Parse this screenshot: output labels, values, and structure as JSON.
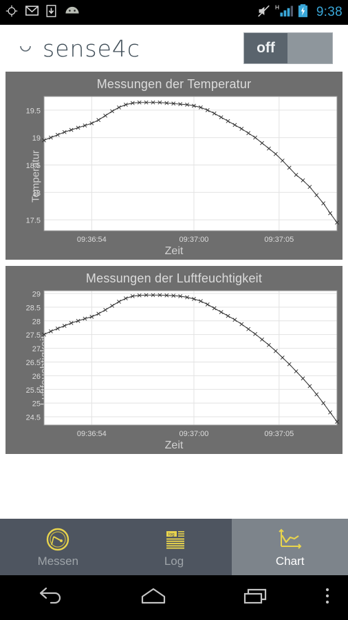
{
  "statusbar": {
    "icons_left": [
      "gps-icon",
      "gmail-icon",
      "download-icon",
      "android-icon"
    ],
    "icons_right": [
      "mute-icon",
      "signal-h-icon",
      "battery-charging-icon"
    ],
    "signal_label": "H",
    "clock": "9:38"
  },
  "header": {
    "logo_text": "sense4c",
    "toggle": {
      "label": "off",
      "state": "off"
    }
  },
  "charts": [
    {
      "title": "Messungen der Temperatur",
      "ylabel": "Temperatur",
      "xlabel": "Zeit"
    },
    {
      "title": "Messungen der Luftfeuchtigkeit",
      "ylabel": "Luftfeuchtigkeit",
      "xlabel": "Zeit"
    }
  ],
  "tabs": [
    {
      "label": "Messen",
      "icon": "gauge-icon",
      "active": false
    },
    {
      "label": "Log",
      "icon": "log-list-icon",
      "active": false
    },
    {
      "label": "Chart",
      "icon": "line-chart-icon",
      "active": true
    }
  ],
  "navbar": {
    "back": "back-icon",
    "home": "home-icon",
    "recents": "recents-icon",
    "overflow": "overflow-menu-icon"
  },
  "colors": {
    "accent_gold": "#e8d44d",
    "panel_bg": "#6e6e6e",
    "tabbar_bg": "#4e5560",
    "tab_active_bg": "#7d848b",
    "status_clock": "#3aa7d8",
    "logo": "#3f4d57"
  },
  "chart_data": [
    {
      "type": "line",
      "title": "Messungen der Temperatur",
      "xlabel": "Zeit",
      "ylabel": "Temperatur",
      "grid": true,
      "legend": null,
      "ytick_labels": [
        "19.5",
        "19",
        "18.5",
        "18",
        "17.5"
      ],
      "yticks": [
        19.5,
        19,
        18.5,
        18,
        17.5
      ],
      "ylim": [
        17.3,
        19.75
      ],
      "xtick_labels": [
        "09:36:54",
        "09:37:00",
        "09:37:05"
      ],
      "xticks": [
        54,
        60,
        65
      ],
      "xlim": [
        51.2,
        68.4
      ],
      "marker": "x",
      "x": [
        51.2,
        51.6,
        52.0,
        52.4,
        52.8,
        53.2,
        53.6,
        54.0,
        54.4,
        54.8,
        55.2,
        55.6,
        56.0,
        56.4,
        56.8,
        57.2,
        57.6,
        58.0,
        58.4,
        58.8,
        59.2,
        59.6,
        60.0,
        60.4,
        60.8,
        61.2,
        61.6,
        62.0,
        62.4,
        62.8,
        63.2,
        63.6,
        64.0,
        64.4,
        64.8,
        65.2,
        65.6,
        66.0,
        66.4,
        66.8,
        67.2,
        67.6,
        68.0,
        68.4
      ],
      "y": [
        18.95,
        19.0,
        19.05,
        19.1,
        19.14,
        19.18,
        19.22,
        19.26,
        19.32,
        19.4,
        19.48,
        19.55,
        19.6,
        19.63,
        19.64,
        19.64,
        19.64,
        19.64,
        19.63,
        19.62,
        19.61,
        19.6,
        19.58,
        19.55,
        19.5,
        19.44,
        19.37,
        19.3,
        19.23,
        19.16,
        19.08,
        19.0,
        18.9,
        18.8,
        18.7,
        18.58,
        18.45,
        18.32,
        18.22,
        18.1,
        17.95,
        17.8,
        17.62,
        17.45
      ]
    },
    {
      "type": "line",
      "title": "Messungen der Luftfeuchtigkeit",
      "xlabel": "Zeit",
      "ylabel": "Luftfeuchtigkeit",
      "grid": true,
      "legend": null,
      "ytick_labels": [
        "29",
        "28.5",
        "28",
        "27.5",
        "27",
        "26.5",
        "26",
        "25.5",
        "25",
        "24.5"
      ],
      "yticks": [
        29,
        28.5,
        28,
        27.5,
        27,
        26.5,
        26,
        25.5,
        25,
        24.5
      ],
      "ylim": [
        24.2,
        29.1
      ],
      "xtick_labels": [
        "09:36:54",
        "09:37:00",
        "09:37:05"
      ],
      "xticks": [
        54,
        60,
        65
      ],
      "xlim": [
        51.2,
        68.4
      ],
      "marker": "x",
      "x": [
        51.2,
        51.6,
        52.0,
        52.4,
        52.8,
        53.2,
        53.6,
        54.0,
        54.4,
        54.8,
        55.2,
        55.6,
        56.0,
        56.4,
        56.8,
        57.2,
        57.6,
        58.0,
        58.4,
        58.8,
        59.2,
        59.6,
        60.0,
        60.4,
        60.8,
        61.2,
        61.6,
        62.0,
        62.4,
        62.8,
        63.2,
        63.6,
        64.0,
        64.4,
        64.8,
        65.2,
        65.6,
        66.0,
        66.4,
        66.8,
        67.2,
        67.6,
        68.0,
        68.4
      ],
      "y": [
        27.5,
        27.62,
        27.72,
        27.82,
        27.92,
        28.0,
        28.08,
        28.15,
        28.26,
        28.4,
        28.55,
        28.7,
        28.82,
        28.9,
        28.93,
        28.94,
        28.94,
        28.94,
        28.93,
        28.92,
        28.9,
        28.86,
        28.8,
        28.72,
        28.6,
        28.46,
        28.32,
        28.18,
        28.04,
        27.88,
        27.7,
        27.52,
        27.32,
        27.12,
        26.9,
        26.66,
        26.42,
        26.16,
        25.9,
        25.62,
        25.32,
        25.0,
        24.66,
        24.32
      ]
    }
  ]
}
